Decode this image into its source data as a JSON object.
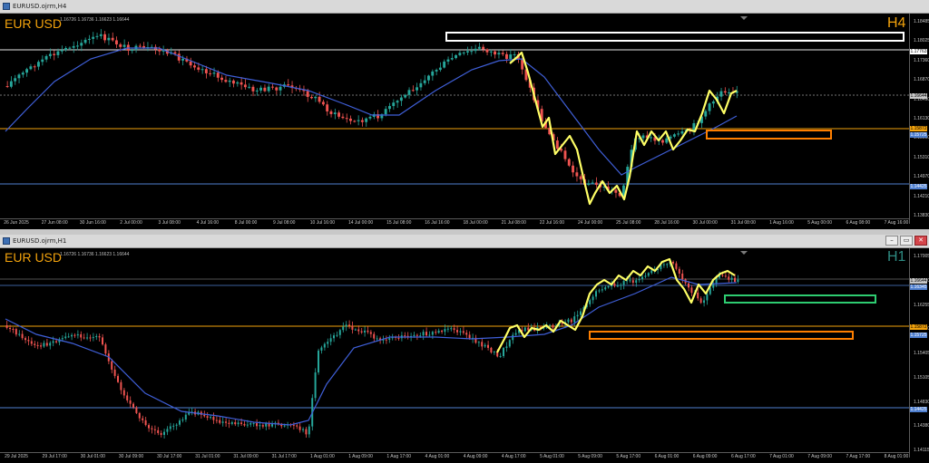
{
  "windows": [
    {
      "id": "h4",
      "title": "EURUSD.ojrm,H4",
      "symbol": "EUR USD",
      "ohlc": "1.16726 1.16736 1.16623 1.16644",
      "timeframe": "H4",
      "timeframe_color": "#f2a20c",
      "price_ticks": [
        "1.18485",
        "1.18025",
        "1.17360",
        "1.16870",
        "1.16490",
        "1.16130",
        "1.15000",
        "1.15310",
        "1.14970",
        "1.14210",
        "1.13830"
      ],
      "price_tags": [
        {
          "label": "1.17763",
          "color": "#ffffff"
        },
        {
          "label": "1.16644",
          "color": "#c8c8c8"
        },
        {
          "label": "1.15872",
          "color": "#f2a20c"
        },
        {
          "label": "1.15725",
          "color": "#4f7fcf"
        },
        {
          "label": "1.14425",
          "color": "#4f7fcf"
        }
      ],
      "time_ticks": [
        "26 Jun 2025",
        "27 Jun 08:00",
        "30 Jun 16:00",
        "2 Jul 00:00",
        "3 Jul 08:00",
        "4 Jul 16:00",
        "8 Jul 00:00",
        "9 Jul 08:00",
        "10 Jul 16:00",
        "14 Jul 00:00",
        "15 Jul 08:00",
        "16 Jul 16:00",
        "18 Jul 00:00",
        "21 Jul 08:00",
        "22 Jul 16:00",
        "24 Jul 00:00",
        "25 Jul 08:00",
        "28 Jul 16:00",
        "30 Jul 00:00",
        "31 Jul 08:00",
        "1 Aug 16:00",
        "5 Aug 00:00",
        "6 Aug 08:00",
        "7 Aug 16:00"
      ]
    },
    {
      "id": "h1",
      "title": "EURUSD.ojrm,H1",
      "symbol": "EUR USD",
      "ohlc": "1.16726 1.16736 1.16623 1.16644",
      "timeframe": "H1",
      "timeframe_color": "#2e8b82",
      "price_ticks": [
        "1.17005",
        "1.16790",
        "1.16255",
        "1.15920",
        "1.15405",
        "1.15105",
        "1.14830",
        "1.14380",
        "1.14115"
      ],
      "price_tags": [
        {
          "label": "1.16644",
          "color": "#c8c8c8"
        },
        {
          "label": "1.16345",
          "color": "#4f7fcf"
        },
        {
          "label": "1.15872",
          "color": "#f2a20c"
        },
        {
          "label": "1.15725",
          "color": "#4f7fcf"
        },
        {
          "label": "1.14425",
          "color": "#4f7fcf"
        }
      ],
      "time_ticks": [
        "29 Jul 2025",
        "29 Jul 17:00",
        "30 Jul 01:00",
        "30 Jul 09:00",
        "30 Jul 17:00",
        "31 Jul 01:00",
        "31 Jul 09:00",
        "31 Jul 17:00",
        "1 Aug 01:00",
        "1 Aug 09:00",
        "1 Aug 17:00",
        "4 Aug 01:00",
        "4 Aug 09:00",
        "4 Aug 17:00",
        "5 Aug 01:00",
        "5 Aug 09:00",
        "5 Aug 17:00",
        "6 Aug 01:00",
        "6 Aug 09:00",
        "6 Aug 17:00",
        "7 Aug 01:00",
        "7 Aug 09:00",
        "7 Aug 17:00",
        "8 Aug 01:00"
      ]
    }
  ],
  "window_buttons": {
    "minimize": "–",
    "restore": "▭",
    "close": "✕"
  },
  "colors": {
    "bull": "#26a69a",
    "bear": "#ef5350",
    "ma": "#3f5fd8",
    "zigzag": "#ffff66",
    "zone_white": "#ffffff",
    "zone_orange": "#ff7f00",
    "zone_green": "#2ecc71"
  }
}
